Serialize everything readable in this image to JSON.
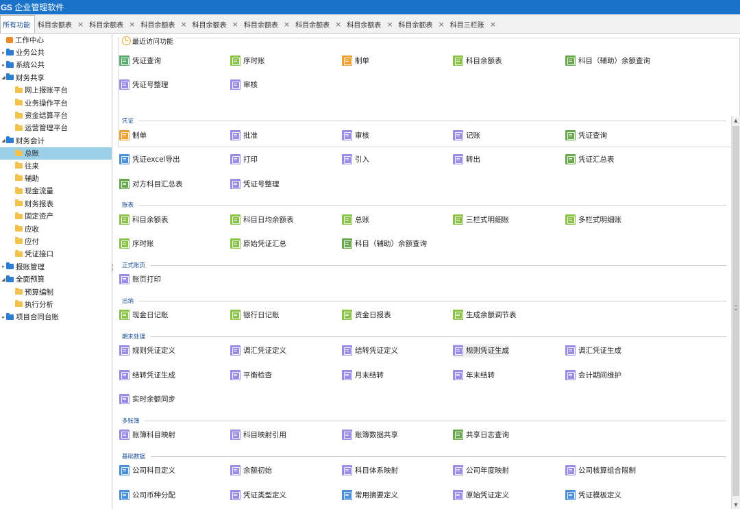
{
  "app": {
    "logo": "GS",
    "title": "企业管理软件"
  },
  "tabs": [
    {
      "label": "所有功能",
      "active": true,
      "closable": false
    },
    {
      "label": "科目余额表",
      "closable": true
    },
    {
      "label": "科目余额表",
      "closable": true
    },
    {
      "label": "科目余额表",
      "closable": true
    },
    {
      "label": "科目余额表",
      "closable": true
    },
    {
      "label": "科目余额表",
      "closable": true
    },
    {
      "label": "科目余额表",
      "closable": true
    },
    {
      "label": "科目余额表",
      "closable": true
    },
    {
      "label": "科目余额表",
      "closable": true
    },
    {
      "label": "科目三栏账",
      "closable": true
    }
  ],
  "tab_close_glyph": "×",
  "sidebar": [
    {
      "label": "工作中心",
      "level": 0,
      "icon": "home-icon",
      "arrow": ""
    },
    {
      "label": "业务公共",
      "level": 0,
      "icon": "folder-icon",
      "arrow": "▸"
    },
    {
      "label": "系统公共",
      "level": 0,
      "icon": "folder-icon",
      "arrow": "▸"
    },
    {
      "label": "财务共享",
      "level": 0,
      "icon": "folder-icon",
      "arrow": "◢"
    },
    {
      "label": "网上报账平台",
      "level": 1,
      "icon": "folder-icon",
      "arrow": ""
    },
    {
      "label": "业务操作平台",
      "level": 1,
      "icon": "folder-icon",
      "arrow": ""
    },
    {
      "label": "资金结算平台",
      "level": 1,
      "icon": "folder-icon",
      "arrow": ""
    },
    {
      "label": "运营管理平台",
      "level": 1,
      "icon": "folder-icon",
      "arrow": ""
    },
    {
      "label": "财务会计",
      "level": 0,
      "icon": "folder-icon",
      "arrow": "◢"
    },
    {
      "label": "总账",
      "level": 1,
      "icon": "folder-icon",
      "arrow": "",
      "selected": true
    },
    {
      "label": "往来",
      "level": 1,
      "icon": "folder-icon",
      "arrow": ""
    },
    {
      "label": "辅助",
      "level": 1,
      "icon": "folder-icon",
      "arrow": ""
    },
    {
      "label": "现金流量",
      "level": 1,
      "icon": "folder-icon",
      "arrow": ""
    },
    {
      "label": "财务报表",
      "level": 1,
      "icon": "folder-icon",
      "arrow": ""
    },
    {
      "label": "固定资产",
      "level": 1,
      "icon": "folder-icon",
      "arrow": ""
    },
    {
      "label": "应收",
      "level": 1,
      "icon": "folder-icon",
      "arrow": ""
    },
    {
      "label": "应付",
      "level": 1,
      "icon": "folder-icon",
      "arrow": ""
    },
    {
      "label": "凭证接口",
      "level": 1,
      "icon": "folder-icon",
      "arrow": ""
    },
    {
      "label": "报账管理",
      "level": 0,
      "icon": "folder-icon",
      "arrow": "▸"
    },
    {
      "label": "全面预算",
      "level": 0,
      "icon": "folder-icon",
      "arrow": "◢"
    },
    {
      "label": "预算编制",
      "level": 1,
      "icon": "folder-icon",
      "arrow": ""
    },
    {
      "label": "执行分析",
      "level": 1,
      "icon": "folder-icon",
      "arrow": ""
    },
    {
      "label": "项目合同台账",
      "level": 0,
      "icon": "folder-icon",
      "arrow": "▸"
    }
  ],
  "recent": {
    "title": "最近访问功能",
    "items": [
      {
        "label": "凭证查询",
        "color": "#5cab6e",
        "icon": "voucher-query-icon"
      },
      {
        "label": "序时账",
        "color": "#8bc34a",
        "icon": "journal-icon"
      },
      {
        "label": "制单",
        "color": "#f0a030",
        "icon": "make-voucher-icon"
      },
      {
        "label": "科目余额表",
        "color": "#8bc34a",
        "icon": "balance-icon"
      },
      {
        "label": "科目（辅助）余额查询",
        "color": "#6aa84f",
        "icon": "aux-balance-icon"
      },
      {
        "label": "凭证号整理",
        "color": "#9c8ce6",
        "icon": "renumber-icon"
      },
      {
        "label": "审核",
        "color": "#9c8ce6",
        "icon": "audit-icon"
      }
    ]
  },
  "sections": [
    {
      "title": "凭证",
      "items": [
        {
          "label": "制单",
          "color": "#f0a030",
          "icon": "make-voucher-icon"
        },
        {
          "label": "批准",
          "color": "#9c8ce6",
          "icon": "approve-icon"
        },
        {
          "label": "审核",
          "color": "#9c8ce6",
          "icon": "audit-icon"
        },
        {
          "label": "记账",
          "color": "#9c8ce6",
          "icon": "post-icon"
        },
        {
          "label": "凭证查询",
          "color": "#6aa84f",
          "icon": "voucher-query-icon"
        },
        {
          "label": "凭证excel导出",
          "color": "#4a8fd8",
          "icon": "excel-export-icon"
        },
        {
          "label": "打印",
          "color": "#9c8ce6",
          "icon": "print-icon"
        },
        {
          "label": "引入",
          "color": "#9c8ce6",
          "icon": "import-icon"
        },
        {
          "label": "转出",
          "color": "#9c8ce6",
          "icon": "export-icon"
        },
        {
          "label": "凭证汇总表",
          "color": "#6aa84f",
          "icon": "summary-icon"
        },
        {
          "label": "对方科目汇总表",
          "color": "#6aa84f",
          "icon": "counter-summary-icon"
        },
        {
          "label": "凭证号整理",
          "color": "#9c8ce6",
          "icon": "renumber-icon"
        }
      ]
    },
    {
      "title": "账表",
      "items": [
        {
          "label": "科目余额表",
          "color": "#8bc34a",
          "icon": "balance-icon"
        },
        {
          "label": "科目日均余额表",
          "color": "#8bc34a",
          "icon": "daily-balance-icon"
        },
        {
          "label": "总账",
          "color": "#8bc34a",
          "icon": "ledger-icon"
        },
        {
          "label": "三栏式明细账",
          "color": "#8bc34a",
          "icon": "three-column-icon"
        },
        {
          "label": "多栏式明细账",
          "color": "#8bc34a",
          "icon": "multi-column-icon"
        },
        {
          "label": "序时账",
          "color": "#8bc34a",
          "icon": "journal-icon"
        },
        {
          "label": "原始凭证汇总",
          "color": "#8bc34a",
          "icon": "original-summary-icon"
        },
        {
          "label": "科目（辅助）余额查询",
          "color": "#6aa84f",
          "icon": "aux-balance-icon"
        }
      ]
    },
    {
      "title": "正式账页",
      "items": [
        {
          "label": "账页打印",
          "color": "#9c8ce6",
          "icon": "print-icon"
        }
      ]
    },
    {
      "title": "出纳",
      "items": [
        {
          "label": "现金日记账",
          "color": "#8bc34a",
          "icon": "cash-journal-icon"
        },
        {
          "label": "银行日记账",
          "color": "#8bc34a",
          "icon": "bank-journal-icon"
        },
        {
          "label": "资金日报表",
          "color": "#8bc34a",
          "icon": "fund-daily-icon"
        },
        {
          "label": "生成余额调节表",
          "color": "#8bc34a",
          "icon": "reconcile-icon"
        }
      ]
    },
    {
      "title": "期末处理",
      "items": [
        {
          "label": "规则凭证定义",
          "color": "#9c8ce6",
          "icon": "rule-define-icon"
        },
        {
          "label": "调汇凭证定义",
          "color": "#9c8ce6",
          "icon": "fx-define-icon"
        },
        {
          "label": "结转凭证定义",
          "color": "#9c8ce6",
          "icon": "carry-define-icon"
        },
        {
          "label": "规则凭证生成",
          "color": "#9c8ce6",
          "icon": "rule-generate-icon",
          "highlight": true
        },
        {
          "label": "调汇凭证生成",
          "color": "#9c8ce6",
          "icon": "fx-generate-icon"
        },
        {
          "label": "结转凭证生成",
          "color": "#9c8ce6",
          "icon": "carry-generate-icon"
        },
        {
          "label": "平衡检查",
          "color": "#9c8ce6",
          "icon": "balance-check-icon"
        },
        {
          "label": "月末结转",
          "color": "#9c8ce6",
          "icon": "month-end-icon"
        },
        {
          "label": "年末结转",
          "color": "#9c8ce6",
          "icon": "year-end-icon"
        },
        {
          "label": "会计期间维护",
          "color": "#9c8ce6",
          "icon": "period-icon"
        },
        {
          "label": "实时余额同步",
          "color": "#9c8ce6",
          "icon": "sync-icon"
        }
      ]
    },
    {
      "title": "多账簿",
      "items": [
        {
          "label": "账簿科目映射",
          "color": "#9c8ce6",
          "icon": "book-map-icon"
        },
        {
          "label": "科目映射引用",
          "color": "#9c8ce6",
          "icon": "map-ref-icon"
        },
        {
          "label": "账簿数据共享",
          "color": "#9c8ce6",
          "icon": "share-icon"
        },
        {
          "label": "共享日志查询",
          "color": "#6aa84f",
          "icon": "log-query-icon"
        }
      ]
    },
    {
      "title": "基础数据",
      "items": [
        {
          "label": "公司科目定义",
          "color": "#4a8fd8",
          "icon": "company-subject-icon"
        },
        {
          "label": "余额初始",
          "color": "#9c8ce6",
          "icon": "init-balance-icon"
        },
        {
          "label": "科目体系映射",
          "color": "#9c8ce6",
          "icon": "system-map-icon"
        },
        {
          "label": "公司年度映射",
          "color": "#9c8ce6",
          "icon": "year-map-icon"
        },
        {
          "label": "公司核算组合限制",
          "color": "#9c8ce6",
          "icon": "combo-limit-icon"
        },
        {
          "label": "公司币种分配",
          "color": "#4a8fd8",
          "icon": "currency-icon"
        },
        {
          "label": "凭证类型定义",
          "color": "#9c8ce6",
          "icon": "type-define-icon"
        },
        {
          "label": "常用摘要定义",
          "color": "#4a8fd8",
          "icon": "abstract-icon"
        },
        {
          "label": "原始凭证定义",
          "color": "#9c8ce6",
          "icon": "original-define-icon"
        },
        {
          "label": "凭证模板定义",
          "color": "#4a8fd8",
          "icon": "template-icon"
        }
      ]
    }
  ]
}
